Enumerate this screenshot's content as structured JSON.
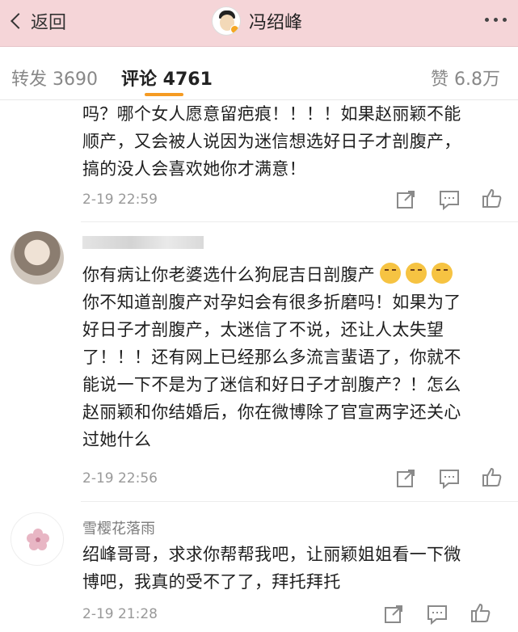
{
  "nav": {
    "back_label": "返回",
    "title": "冯绍峰"
  },
  "tabs": {
    "repost": "转发 3690",
    "comments": "评论 4761",
    "likes": "赞 6.8万"
  },
  "comments": [
    {
      "lines": [
        "吗？哪个女人愿意留疤痕！！！！如果赵丽颖不能",
        "顺产，又会被人说因为迷信想选好日子才剖腹产，",
        "搞的没人会喜欢她你才满意！"
      ],
      "time": "2-19 22:59"
    },
    {
      "lines": [
        "你有病让你老婆选什么狗屁吉日剖腹产",
        "你不知道剖腹产对孕妇会有很多折磨吗！如果为了",
        "好日子才剖腹产，太迷信了不说，还让人太失望",
        "了！！！还有网上已经那么多流言蜚语了，你就不",
        "能说一下不是为了迷信和好日子才剖腹产？！怎么",
        "赵丽颖和你结婚后，你在微博除了官宣两字还关心",
        "过她什么"
      ],
      "time": "2-19 22:56"
    },
    {
      "name": "雪樱花落雨",
      "lines": [
        "绍峰哥哥，求求你帮帮我吧，让丽颖姐姐看一下微",
        "博吧，我真的受不了了，拜托拜托"
      ],
      "time": "2-19 21:28"
    }
  ],
  "icons": [
    "back-chevron-icon",
    "more-dots-icon",
    "share-icon",
    "comment-icon",
    "like-icon",
    "flower-icon",
    "emoji-icon"
  ]
}
